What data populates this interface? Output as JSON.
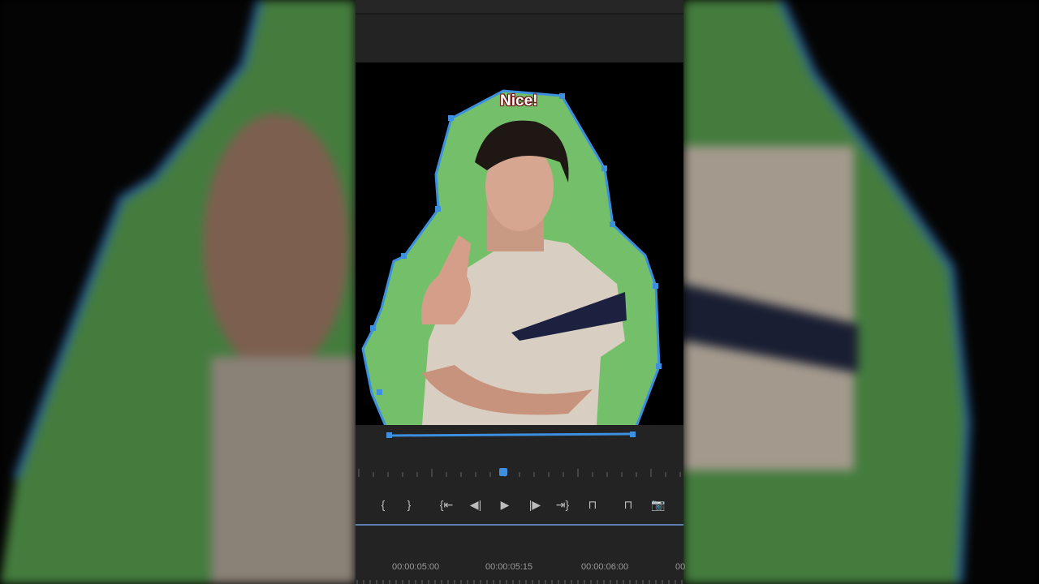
{
  "caption": "Nice!",
  "controls": [
    {
      "name": "mark-in",
      "glyph": "{"
    },
    {
      "name": "mark-out",
      "glyph": "}"
    },
    {
      "name": "go-to-in",
      "glyph": "{⇤"
    },
    {
      "name": "step-back",
      "glyph": "◀|"
    },
    {
      "name": "play",
      "glyph": "▶"
    },
    {
      "name": "step-forward",
      "glyph": "|▶"
    },
    {
      "name": "go-to-out",
      "glyph": "⇥}"
    },
    {
      "name": "insert",
      "glyph": "⊓"
    },
    {
      "name": "overwrite",
      "glyph": "⊓"
    },
    {
      "name": "export-frame",
      "glyph": "📷"
    }
  ],
  "timecodes": [
    "00:00:05:00",
    "00:00:05:15",
    "00:00:06:00",
    "00"
  ],
  "colors": {
    "mask": "#3d8fe0",
    "green": "#74c06a",
    "panel": "#232323"
  }
}
